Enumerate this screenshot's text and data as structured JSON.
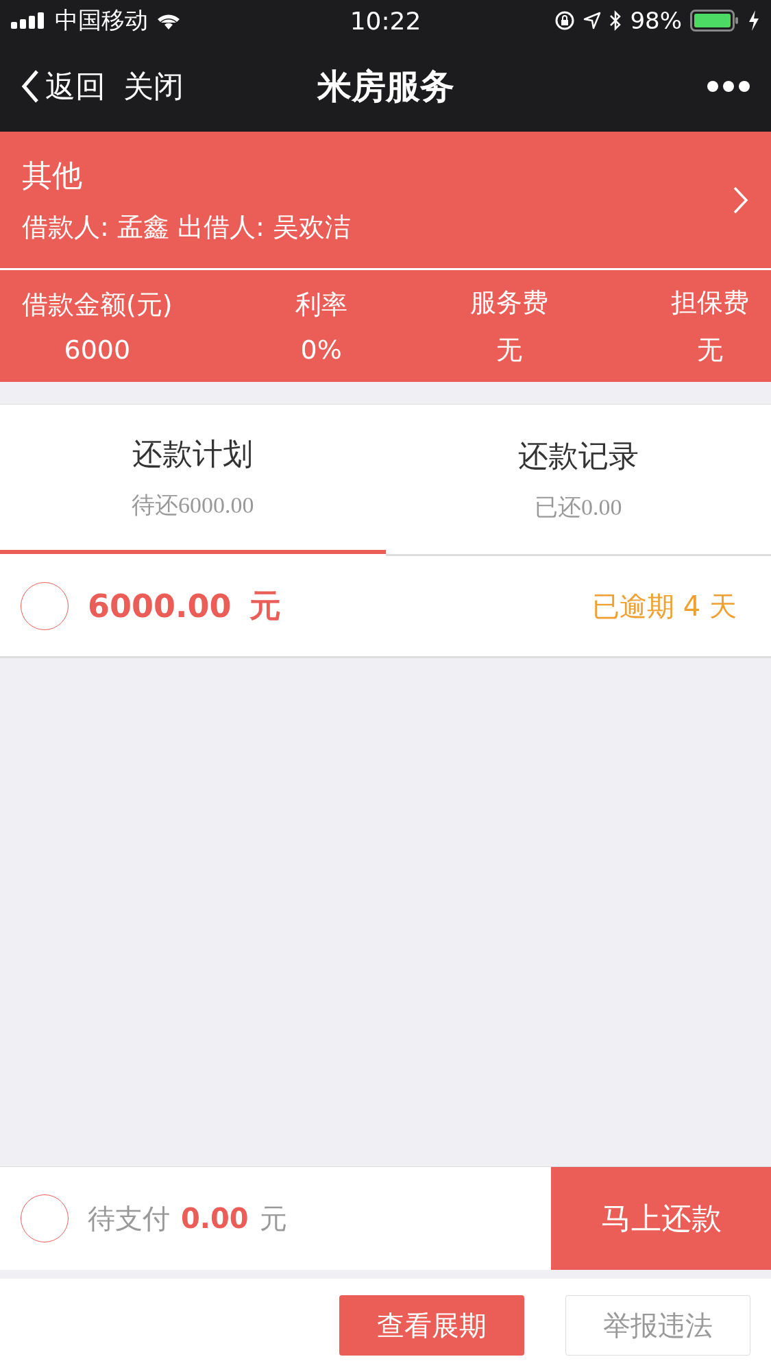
{
  "status_bar": {
    "carrier": "中国移动",
    "time": "10:22",
    "battery": "98%"
  },
  "nav": {
    "back": "返回",
    "close": "关闭",
    "title": "米房服务"
  },
  "loan": {
    "category": "其他",
    "parties": "借款人: 孟鑫 出借人: 吴欢洁"
  },
  "stats": [
    {
      "label": "借款金额(元)",
      "value": "6000"
    },
    {
      "label": "利率",
      "value": "0%"
    },
    {
      "label": "服务费",
      "value": "无"
    },
    {
      "label": "担保费",
      "value": "无"
    }
  ],
  "tabs": [
    {
      "label": "还款计划",
      "sub": "待还6000.00",
      "selected": true
    },
    {
      "label": "还款记录",
      "sub": "已还0.00",
      "selected": false
    }
  ],
  "installments": [
    {
      "amount": "6000.00",
      "unit": "元",
      "status": "已逾期 4 天",
      "checked": false
    }
  ],
  "footer": {
    "checked": false,
    "label": "待支付",
    "amount": "0.00",
    "unit": "元",
    "pay_button": "马上还款"
  },
  "actions": [
    {
      "label": "查看展期",
      "kind": "primary"
    },
    {
      "label": "举报违法",
      "kind": "outline"
    }
  ]
}
